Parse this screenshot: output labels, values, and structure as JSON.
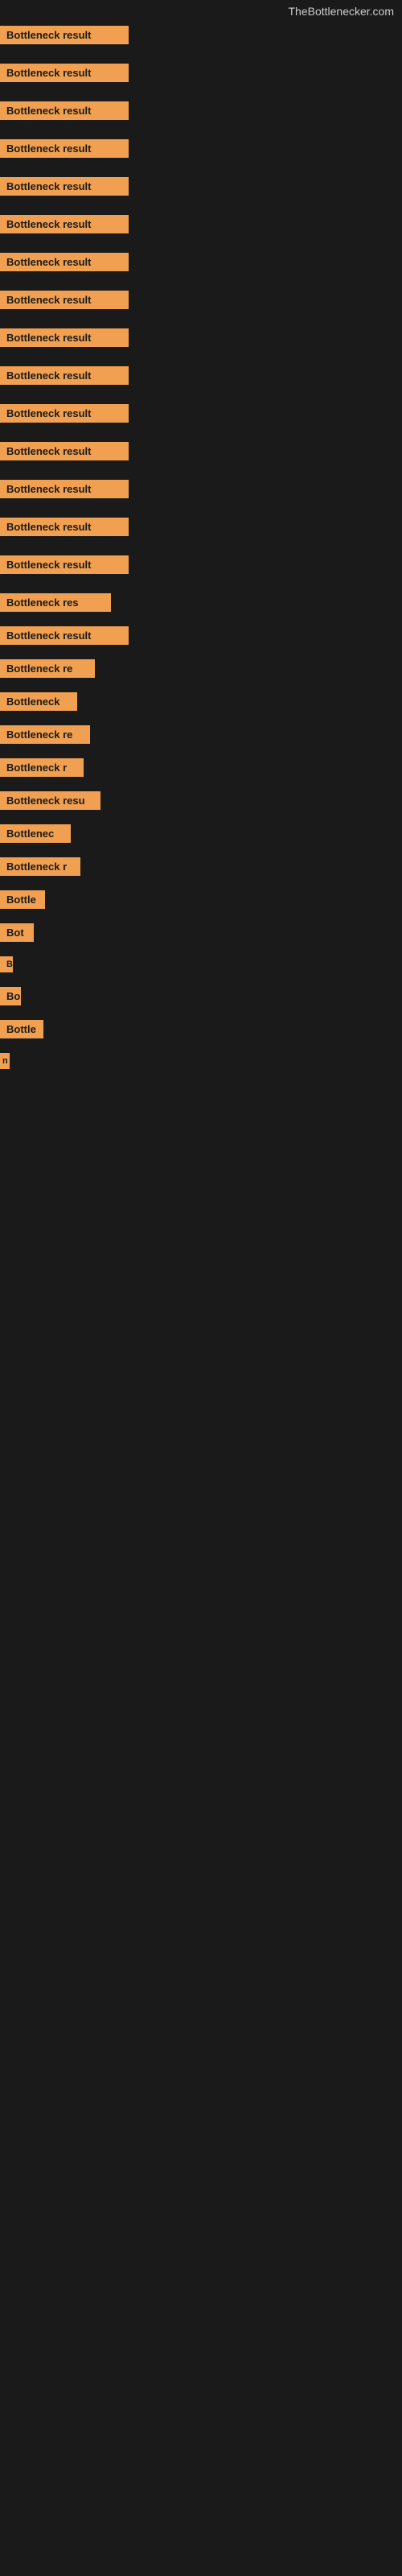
{
  "site": {
    "title": "TheBottlenecker.com"
  },
  "label": "Bottleneck result",
  "rows": [
    {
      "width": "full",
      "text": "Bottleneck result"
    },
    {
      "width": "full",
      "text": "Bottleneck result"
    },
    {
      "width": "full",
      "text": "Bottleneck result"
    },
    {
      "width": "full",
      "text": "Bottleneck result"
    },
    {
      "width": "full",
      "text": "Bottleneck result"
    },
    {
      "width": "full",
      "text": "Bottleneck result"
    },
    {
      "width": "full",
      "text": "Bottleneck result"
    },
    {
      "width": "full",
      "text": "Bottleneck result"
    },
    {
      "width": "full",
      "text": "Bottleneck result"
    },
    {
      "width": "full",
      "text": "Bottleneck result"
    },
    {
      "width": "full",
      "text": "Bottleneck result"
    },
    {
      "width": "full",
      "text": "Bottleneck result"
    },
    {
      "width": "full",
      "text": "Bottleneck result"
    },
    {
      "width": "full",
      "text": "Bottleneck result"
    },
    {
      "width": "full",
      "text": "Bottleneck result"
    },
    {
      "width": "lg",
      "text": "Bottleneck res"
    },
    {
      "width": "full",
      "text": "Bottleneck result"
    },
    {
      "width": "lg",
      "text": "Bottleneck re"
    },
    {
      "width": "md",
      "text": "Bottleneck"
    },
    {
      "width": "lg",
      "text": "Bottleneck re"
    },
    {
      "width": "md",
      "text": "Bottleneck r"
    },
    {
      "width": "lg",
      "text": "Bottleneck resu"
    },
    {
      "width": "md",
      "text": "Bottlenec"
    },
    {
      "width": "lg",
      "text": "Bottleneck r"
    },
    {
      "width": "sm",
      "text": "Bottle"
    },
    {
      "width": "xs",
      "text": "Bot"
    },
    {
      "width": "xxs",
      "text": "B"
    },
    {
      "width": "xs",
      "text": "Bo"
    },
    {
      "width": "sm",
      "text": "Bottle"
    },
    {
      "width": "6xs",
      "text": "n"
    }
  ],
  "colors": {
    "label_bg": "#f0a050",
    "label_text": "#1a1a1a",
    "background": "#1a1a1a",
    "site_title": "#cccccc"
  }
}
